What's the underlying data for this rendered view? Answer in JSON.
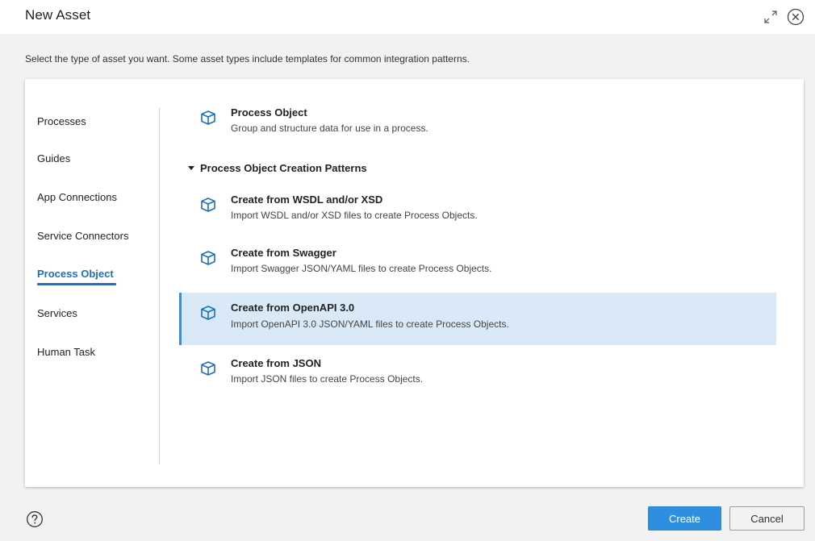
{
  "dialog": {
    "title": "New Asset",
    "instruction": "Select the type of asset you want. Some asset types include templates for common integration patterns."
  },
  "nav": {
    "items": [
      {
        "label": "Processes"
      },
      {
        "label": "Guides"
      },
      {
        "label": "App Connections"
      },
      {
        "label": "Service Connectors"
      },
      {
        "label": "Process Object",
        "active": true
      },
      {
        "label": "Services"
      },
      {
        "label": "Human Task"
      }
    ]
  },
  "assets": {
    "process_object": {
      "name": "Process Object",
      "description": "Group and structure data for use in a process.",
      "icon": "cube-icon"
    },
    "group_header": "Process Object Creation Patterns",
    "patterns": [
      {
        "name": "Create from WSDL and/or XSD",
        "description": "Import WSDL and/or XSD files to create Process Objects.",
        "icon": "cube-icon"
      },
      {
        "name": "Create from Swagger",
        "description": "Import Swagger JSON/YAML files to create Process Objects.",
        "icon": "cube-icon"
      },
      {
        "name": "Create from OpenAPI 3.0",
        "description": "Import OpenAPI 3.0 JSON/YAML files to create Process Objects.",
        "icon": "cube-icon",
        "selected": true
      },
      {
        "name": "Create from JSON",
        "description": "Import JSON files to create Process Objects.",
        "icon": "cube-icon"
      }
    ]
  },
  "footer": {
    "create_label": "Create",
    "cancel_label": "Cancel",
    "help_icon": "help-icon"
  },
  "colors": {
    "accent": "#1d6fb8",
    "primary_button": "#2e8fe0",
    "selection_bg": "#d9e9f7",
    "selection_bar": "#3a8fd8"
  }
}
